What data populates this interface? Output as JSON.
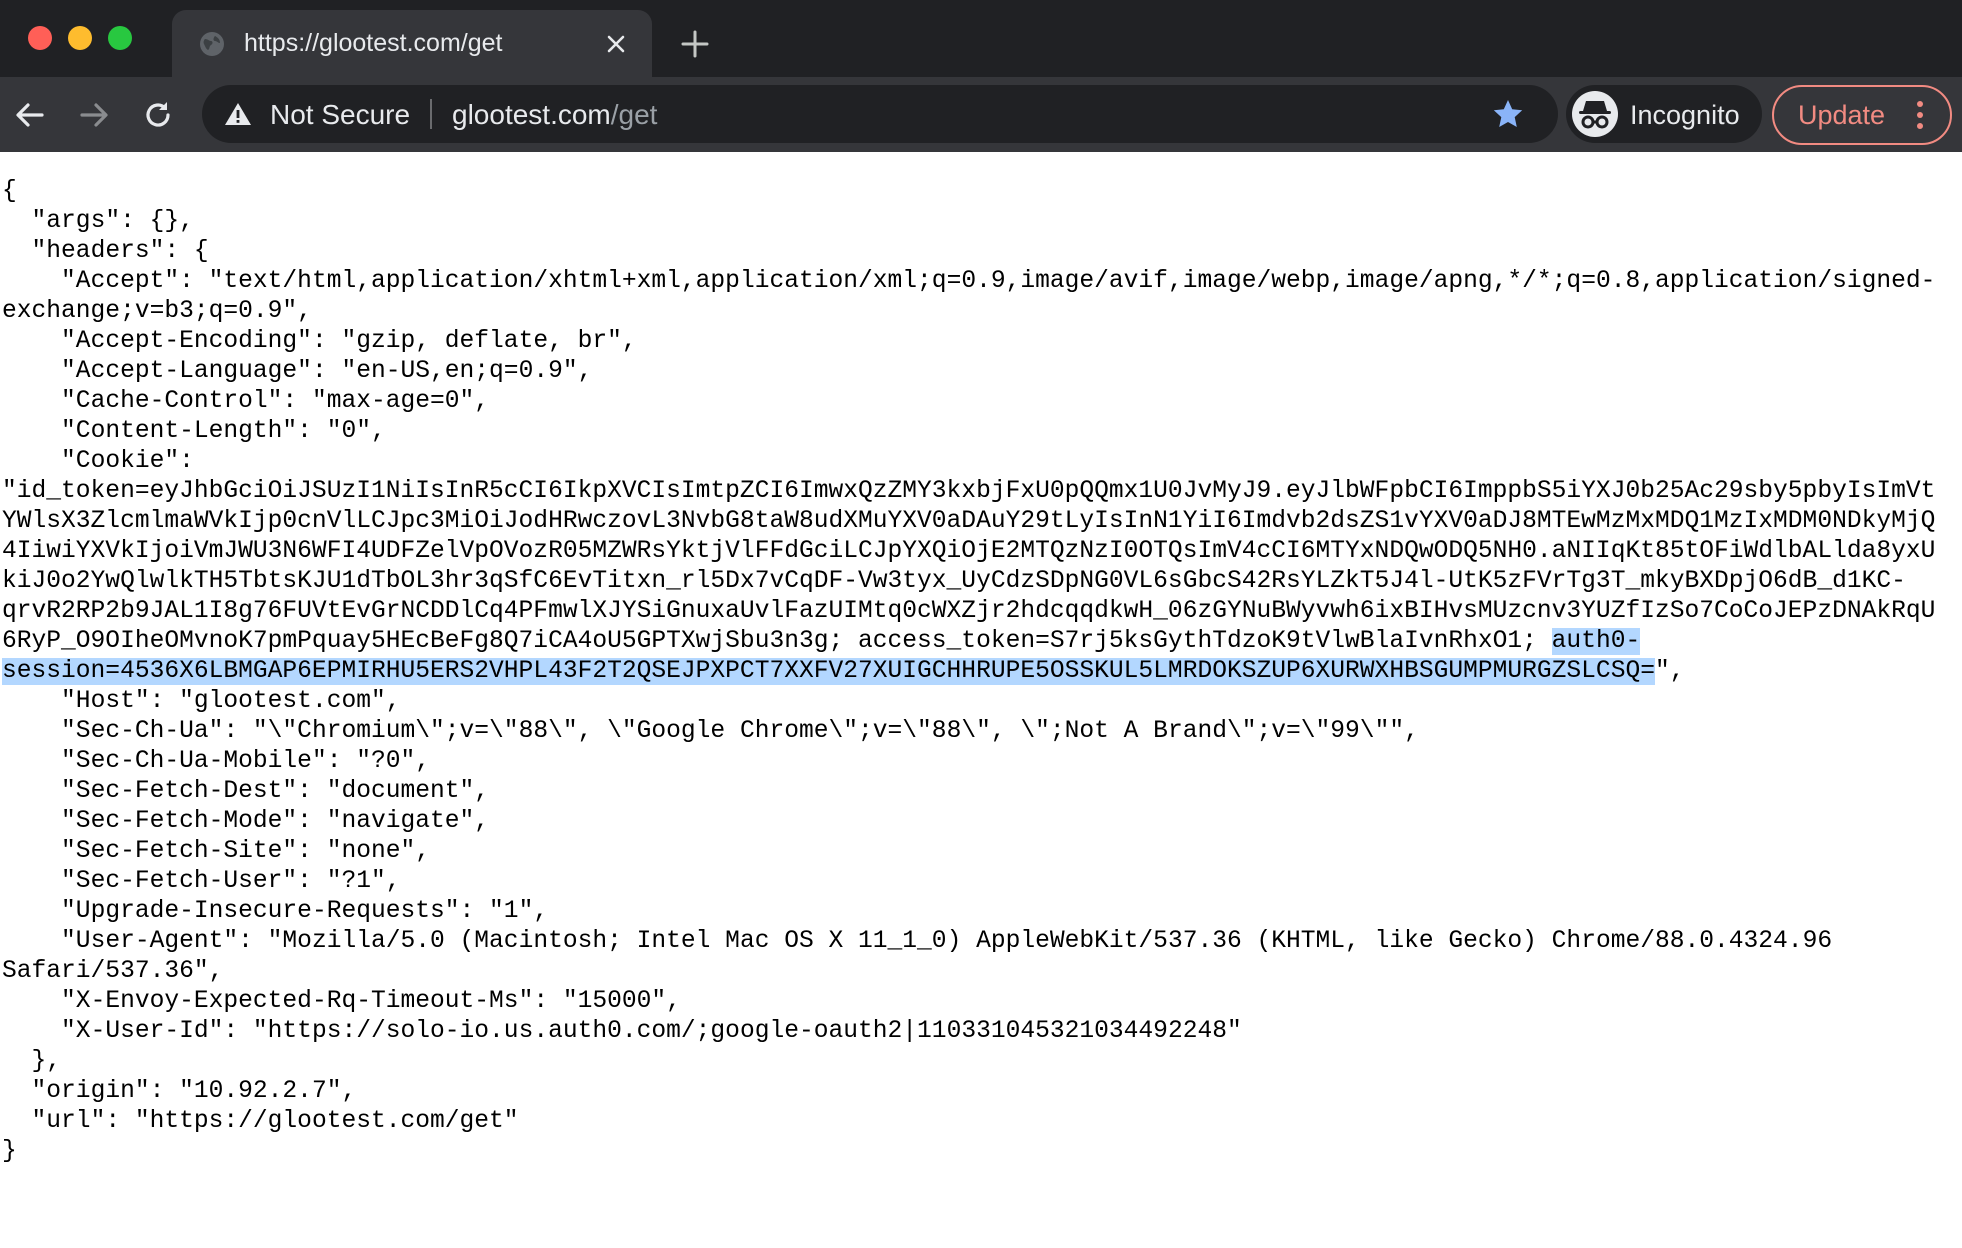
{
  "window": {
    "tab_title": "https://glootest.com/get"
  },
  "toolbar": {
    "security_label": "Not Secure",
    "url_host": "glootest.com",
    "url_path": "/get",
    "profile_label": "Incognito",
    "update_label": "Update"
  },
  "colors": {
    "bookmark_star": "#8ab4f8",
    "update_accent": "#f28b82",
    "selection_highlight": "#b3d7ff"
  },
  "icons": {
    "favicon": "globe-icon",
    "tab_close": "close-icon",
    "new_tab": "plus-icon",
    "back": "arrow-left-icon",
    "forward": "arrow-right-icon",
    "reload": "reload-icon",
    "security": "warning-triangle-icon",
    "bookmark": "star-icon",
    "profile": "incognito-icon",
    "menu": "kebab-menu-icon"
  },
  "response": {
    "line_01": "{",
    "line_02": "  \"args\": {},",
    "line_03": "  \"headers\": {",
    "line_04": "    \"Accept\": \"text/html,application/xhtml+xml,application/xml;q=0.9,image/avif,image/webp,image/apng,*/*;q=0.8,application/signed-exchange;v=b3;q=0.9\",",
    "line_05": "    \"Accept-Encoding\": \"gzip, deflate, br\",",
    "line_06": "    \"Accept-Language\": \"en-US,en;q=0.9\",",
    "line_07": "    \"Cache-Control\": \"max-age=0\",",
    "line_08": "    \"Content-Length\": \"0\",",
    "line_09_pre": "    \"Cookie\": \"id_token=eyJhbGciOiJSUzI1NiIsInR5cCI6IkpXVCIsImtpZCI6ImwxQzZMY3kxbjFxU0pQQmx1U0JvMyJ9.eyJlbWFpbCI6ImppbS5iYXJ0b25Ac29sby5pbyIsImVtYWlsX3ZlcmlmaWVkIjp0cnVlLCJpc3MiOiJodHRwczovL3NvbG8taW8udXMuYXV0aDAuY29tLyIsInN1YiI6Imdvb2dsZS1vYXV0aDJ8MTEwMzMxMDQ1MzIxMDM0NDkyMjQ4IiwiYXVkIjoiVmJWU3N6WFI4UDFZelVpOVozR05MZWRsYktjVlFFdGciLCJpYXQiOjE2MTQzNzI0OTQsImV4cCI6MTYxNDQwODQ5NH0.aNIIqKt85tOFiWdlbALlda8yxUkiJ0o2YwQlwlkTH5TbtsKJU1dTbOL3hr3qSfC6EvTitxn_rl5Dx7vCqDF-Vw3tyx_UyCdzSDpNG0VL6sGbcS42RsYLZkT5J4l-UtK5zFVrTg3T_mkyBXDpjO6dB_d1KC-qrvR2RP2b9JAL1I8g76FUVtEvGrNCDDlCq4PFmwlXJYSiGnuxaUvlFazUIMtq0cWXZjr2hdcqqdkwH_06zGYNuBWyvwh6ixBIHvsMUzcnv3YUZfIzSo7CoCoJEPzDNAkRqU6RyP_O9OIheOMvnoK7pmPquay5HEcBeFg8Q7iCA4oU5GPTXwjSbu3n3g; access_token=S7rj5ksGythTdzoK9tVlwBlaIvnRhxO1; ",
    "line_09_selected": "auth0-session=4536X6LBMGAP6EPMIRHU5ERS2VHPL43F2T2QSEJPXPCT7XXFV27XUIGCHHRUPE5OSSKUL5LMRDOKSZUP6XURWXHBSGUMPMURGZSLCSQ=",
    "line_09_post": "\",",
    "line_10": "    \"Host\": \"glootest.com\",",
    "line_11": "    \"Sec-Ch-Ua\": \"\\\"Chromium\\\";v=\\\"88\\\", \\\"Google Chrome\\\";v=\\\"88\\\", \\\";Not A Brand\\\";v=\\\"99\\\"\",",
    "line_12": "    \"Sec-Ch-Ua-Mobile\": \"?0\",",
    "line_13": "    \"Sec-Fetch-Dest\": \"document\",",
    "line_14": "    \"Sec-Fetch-Mode\": \"navigate\",",
    "line_15": "    \"Sec-Fetch-Site\": \"none\",",
    "line_16": "    \"Sec-Fetch-User\": \"?1\",",
    "line_17": "    \"Upgrade-Insecure-Requests\": \"1\",",
    "line_18": "    \"User-Agent\": \"Mozilla/5.0 (Macintosh; Intel Mac OS X 11_1_0) AppleWebKit/537.36 (KHTML, like Gecko) Chrome/88.0.4324.96 Safari/537.36\",",
    "line_19": "    \"X-Envoy-Expected-Rq-Timeout-Ms\": \"15000\",",
    "line_20": "    \"X-User-Id\": \"https://solo-io.us.auth0.com/;google-oauth2|110331045321034492248\"",
    "line_21": "  },",
    "line_22": "  \"origin\": \"10.92.2.7\",",
    "line_23": "  \"url\": \"https://glootest.com/get\"",
    "line_24": "}"
  }
}
